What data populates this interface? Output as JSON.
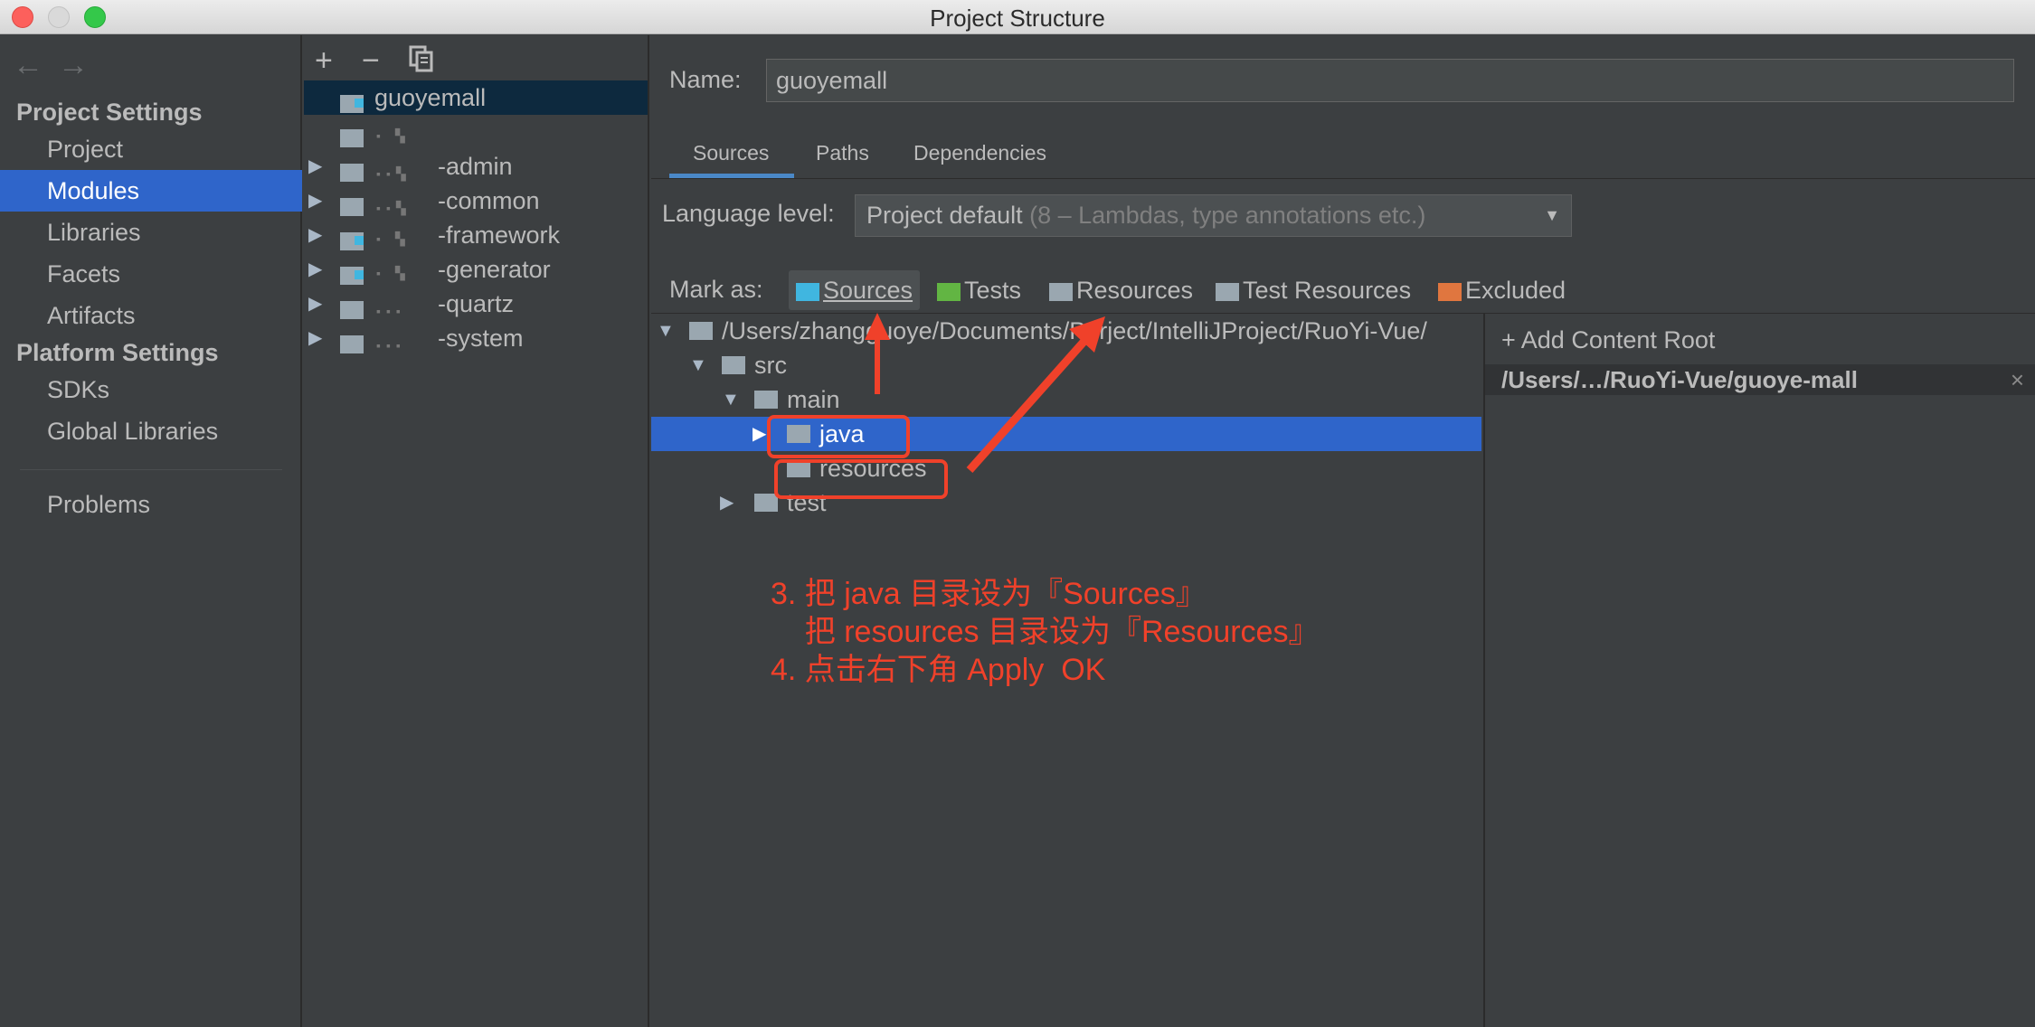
{
  "window": {
    "title": "Project Structure"
  },
  "nav": {
    "back_icon": "arrow-left-icon",
    "forward_icon": "arrow-right-icon"
  },
  "sidebar": {
    "project_settings_title": "Project Settings",
    "project_items": [
      "Project",
      "Modules",
      "Libraries",
      "Facets",
      "Artifacts"
    ],
    "platform_settings_title": "Platform Settings",
    "platform_items": [
      "SDKs",
      "Global Libraries"
    ],
    "problems": "Problems",
    "selected": "Modules"
  },
  "modules": {
    "toolbar": {
      "add": "+",
      "remove": "−",
      "copy_icon": "copy-icon"
    },
    "items": [
      "guoyemall",
      "",
      "-admin",
      "-common",
      "-framework",
      "-generator",
      "-quartz",
      "-system"
    ]
  },
  "content": {
    "name_label": "Name:",
    "name_value": "guoyemall",
    "tabs": [
      "Sources",
      "Paths",
      "Dependencies"
    ],
    "active_tab": "Sources",
    "language_label": "Language level:",
    "language_value": "Project default",
    "language_hint": "(8 – Lambdas, type annotations etc.)",
    "mark_label": "Mark as:",
    "mark_buttons": [
      "Sources",
      "Tests",
      "Resources",
      "Test Resources",
      "Excluded"
    ],
    "tree": {
      "root": "/Users/zhangguoye/Documents/Porject/IntelliJProject/RuoYi-Vue/",
      "src": "src",
      "main": "main",
      "java": "java",
      "resources": "resources",
      "test": "test"
    },
    "add_content_root": "Add Content Root",
    "content_root_path": "/Users/…/RuoYi-Vue/guoye-mall",
    "close_icon": "×"
  },
  "annotation": {
    "line1": "3. 把 java 目录设为『Sources』",
    "line2": "    把 resources 目录设为『Resources』",
    "line3": "4. 点击右下角 Apply  OK",
    "color": "#f0412a"
  }
}
